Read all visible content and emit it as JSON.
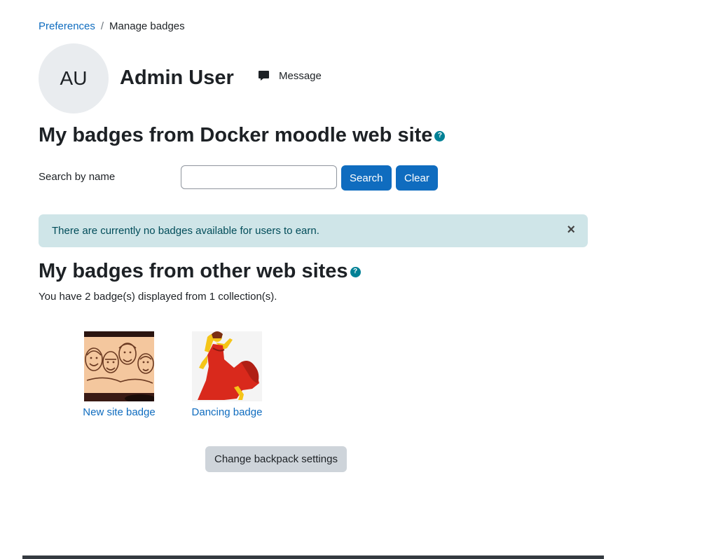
{
  "breadcrumb": {
    "items": [
      {
        "label": "Preferences"
      },
      {
        "label": "Manage badges"
      }
    ],
    "separator": "/"
  },
  "user": {
    "initials": "AU",
    "name": "Admin User",
    "message_label": "Message"
  },
  "site_badges": {
    "heading": "My badges from Docker moodle web site",
    "help_icon": "?"
  },
  "search": {
    "label": "Search by name",
    "value": "",
    "placeholder": "",
    "search_label": "Search",
    "clear_label": "Clear"
  },
  "alert": {
    "text": "There are currently no badges available for users to earn.",
    "close_symbol": "×"
  },
  "external_badges": {
    "heading": "My badges from other web sites",
    "help_icon": "?",
    "summary": "You have 2 badge(s) displayed from 1 collection(s).",
    "badges": [
      {
        "name": "New site badge",
        "icon": "caricature-group-image"
      },
      {
        "name": "Dancing badge",
        "icon": "dancing-woman-image"
      }
    ],
    "settings_label": "Change backpack settings"
  },
  "colors": {
    "link": "#0f6cbf",
    "primary_button": "#0f6cbf",
    "info_alert_bg": "#cfe5e8",
    "help_icon": "#008196",
    "secondary_button": "#ced4da"
  }
}
